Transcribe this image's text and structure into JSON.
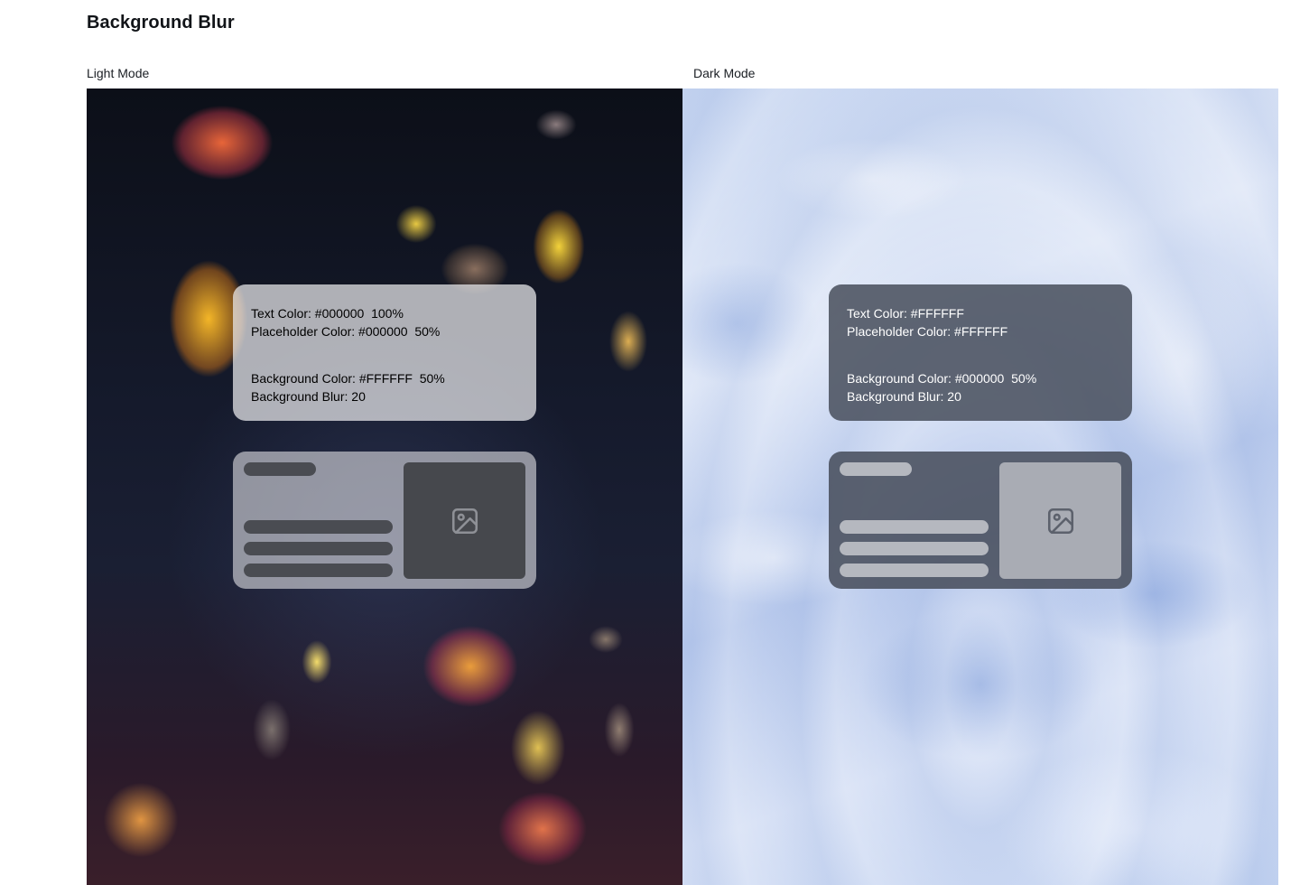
{
  "page": {
    "title": "Background Blur"
  },
  "light": {
    "label": "Light Mode",
    "card": {
      "text_color": "Text Color: #000000  100%",
      "placeholder_color": "Placeholder Color: #000000  50%",
      "background_color": "Background Color: #FFFFFF  50%",
      "background_blur": "Background Blur: 20"
    },
    "placeholder_icon": "image-icon"
  },
  "dark": {
    "label": "Dark Mode",
    "card": {
      "text_color": "Text Color: #FFFFFF",
      "placeholder_color": "Placeholder Color: #FFFFFF",
      "background_color": "Background Color: #000000  50%",
      "background_blur": "Background Blur: 20"
    },
    "placeholder_icon": "image-icon"
  },
  "colors": {
    "light_text": "#000000",
    "dark_text": "#FFFFFF",
    "light_card_bg": "#FFFFFF",
    "dark_card_bg": "#000000"
  }
}
